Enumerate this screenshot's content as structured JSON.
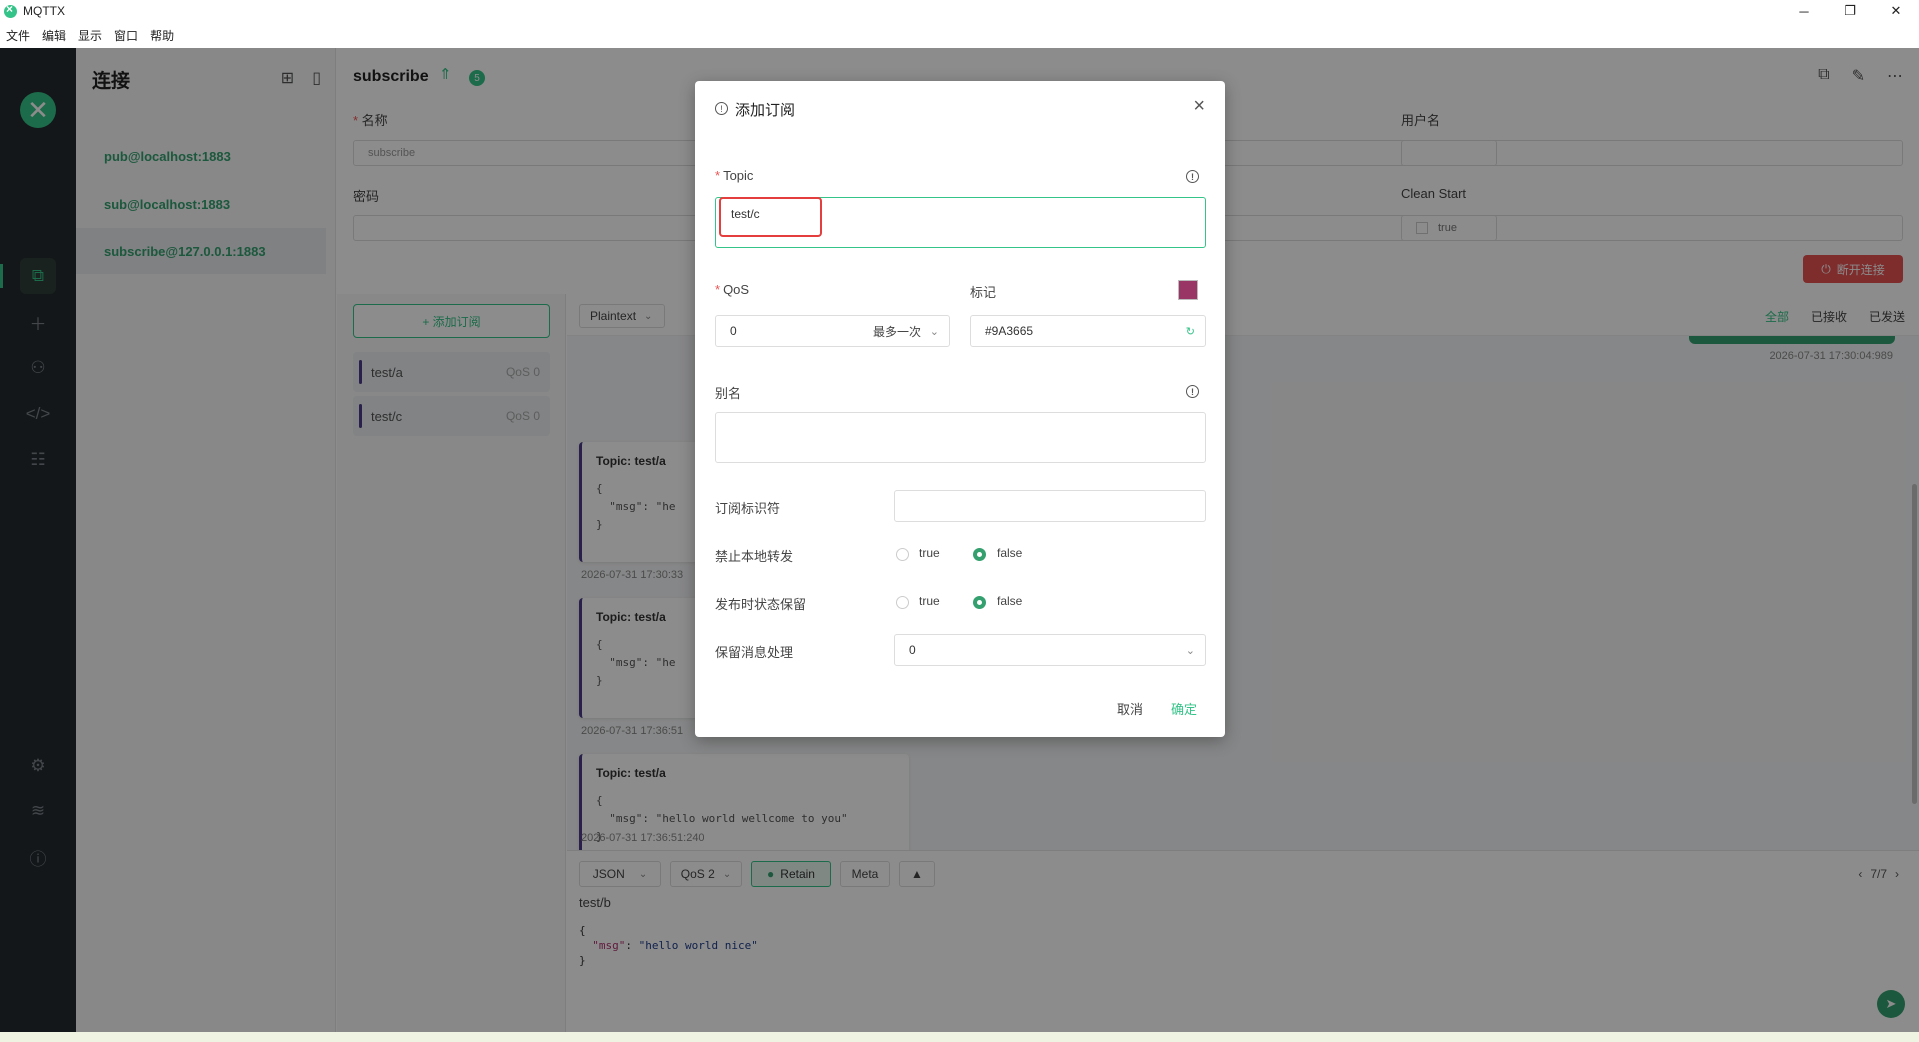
{
  "window": {
    "title": "MQTTX"
  },
  "menu": [
    "文件",
    "编辑",
    "显示",
    "窗口",
    "帮助"
  ],
  "connections": {
    "title": "连接",
    "items": [
      "pub@localhost:1883",
      "sub@localhost:1883",
      "subscribe@127.0.0.1:1883"
    ]
  },
  "main": {
    "title": "subscribe",
    "badge": "5",
    "labels": {
      "name": "名称",
      "password": "密码",
      "username": "用户名",
      "clean_start": "Clean Start"
    },
    "name_value": "subscribe",
    "clean_start_value": "true",
    "disconnect": "断开连接"
  },
  "subscriptions": {
    "add_label": "+ 添加订阅",
    "items": [
      {
        "topic": "test/a",
        "qos": "QoS 0"
      },
      {
        "topic": "test/c",
        "qos": "QoS 0"
      }
    ]
  },
  "messages": {
    "format": "Plaintext",
    "filters": [
      "全部",
      "已接收",
      "已发送"
    ],
    "sent_time": "2026-07-31 17:30:04:989",
    "items": [
      {
        "topic": "Topic: test/a",
        "body": "{\n  \"msg\": \"he\n}",
        "time": "2026-07-31 17:30:33"
      },
      {
        "topic": "Topic: test/a",
        "body": "{\n  \"msg\": \"he\n}",
        "time": "2026-07-31 17:36:51"
      },
      {
        "topic": "Topic: test/a",
        "body": "{\n  \"msg\": \"hello world wellcome to you\"\n}",
        "time": "2026-07-31 17:36:51:240"
      }
    ]
  },
  "composer": {
    "format": "JSON",
    "qos": "QoS 2",
    "retain": "Retain",
    "meta": "Meta",
    "pager": "7/7",
    "topic": "test/b",
    "body_key": "\"msg\"",
    "body_val": "\"hello world nice\""
  },
  "dialog": {
    "title": "添加订阅",
    "topic_label": "Topic",
    "topic_value": "test/c",
    "qos_label": "QoS",
    "qos_value": "0",
    "qos_desc": "最多一次",
    "mark_label": "标记",
    "color_value": "#9A3665",
    "alias_label": "别名",
    "sub_id_label": "订阅标识符",
    "no_local_label": "禁止本地转发",
    "retain_as_published_label": "发布时状态保留",
    "retain_handling_label": "保留消息处理",
    "retain_handling_value": "0",
    "true_label": "true",
    "false_label": "false",
    "cancel": "取消",
    "confirm": "确定"
  }
}
